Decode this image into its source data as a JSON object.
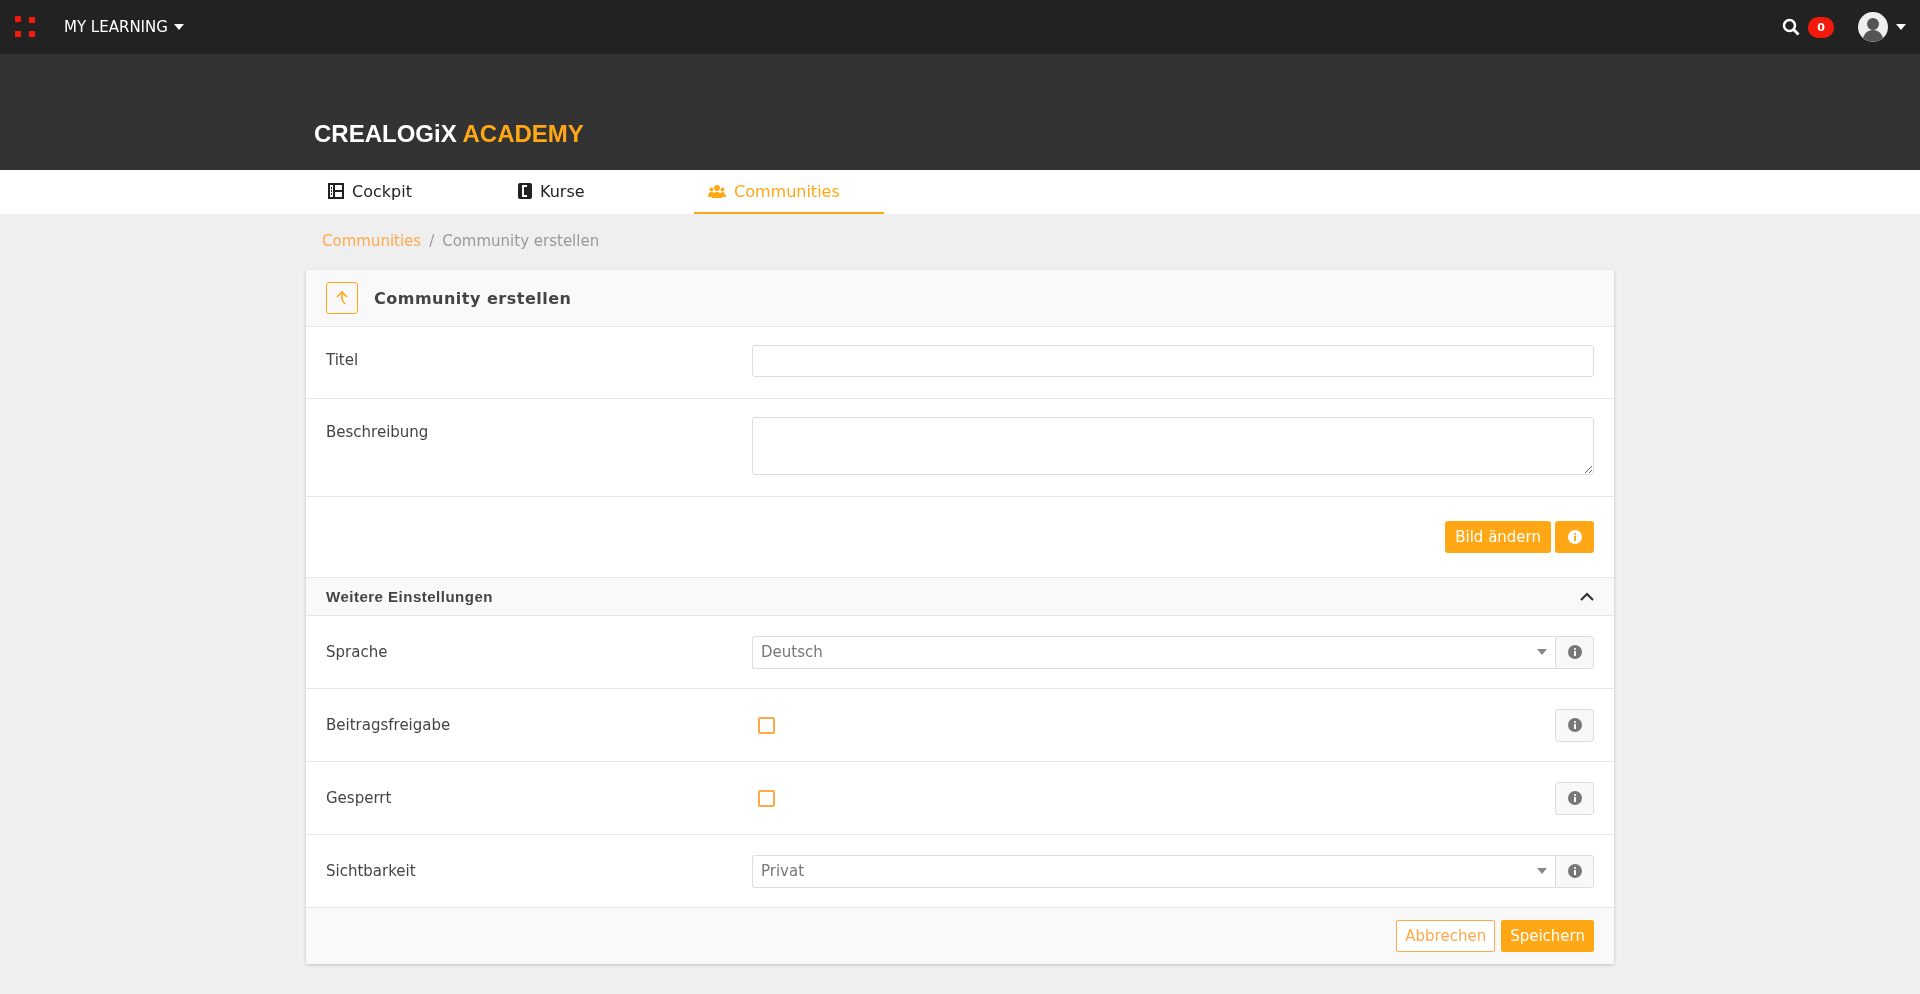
{
  "topbar": {
    "menu_label": "MY LEARNING",
    "notification_count": "0"
  },
  "logo": {
    "brand": "CREALOGiX",
    "product": "ACADEMY"
  },
  "tabs": [
    {
      "label": "Cockpit",
      "selected": false
    },
    {
      "label": "Kurse",
      "selected": false
    },
    {
      "label": "Communities",
      "selected": true
    }
  ],
  "breadcrumb": {
    "separator": "/",
    "items": [
      {
        "label": "Communities",
        "kind": "link"
      },
      {
        "label": "Community erstellen",
        "kind": "current"
      }
    ]
  },
  "form": {
    "title": "Community erstellen",
    "fields": [
      {
        "label": "Titel",
        "kind": "input"
      },
      {
        "label": "Beschreibung",
        "kind": "textarea"
      }
    ],
    "image_button": "Bild ändern",
    "section": {
      "title": "Weitere Einstellungen",
      "expanded": true,
      "rows": [
        {
          "label": "Sprache",
          "kind": "select",
          "value": "Deutsch"
        },
        {
          "label": "Beitragsfreigabe",
          "kind": "checkbox",
          "checked": false
        },
        {
          "label": "Gesperrt",
          "kind": "checkbox",
          "checked": false
        },
        {
          "label": "Sichtbarkeit",
          "kind": "select",
          "value": "Privat"
        }
      ]
    },
    "buttons": [
      {
        "label": "Abbrechen",
        "kind": "secondary"
      },
      {
        "label": "Speichern",
        "kind": "primary"
      }
    ]
  }
}
